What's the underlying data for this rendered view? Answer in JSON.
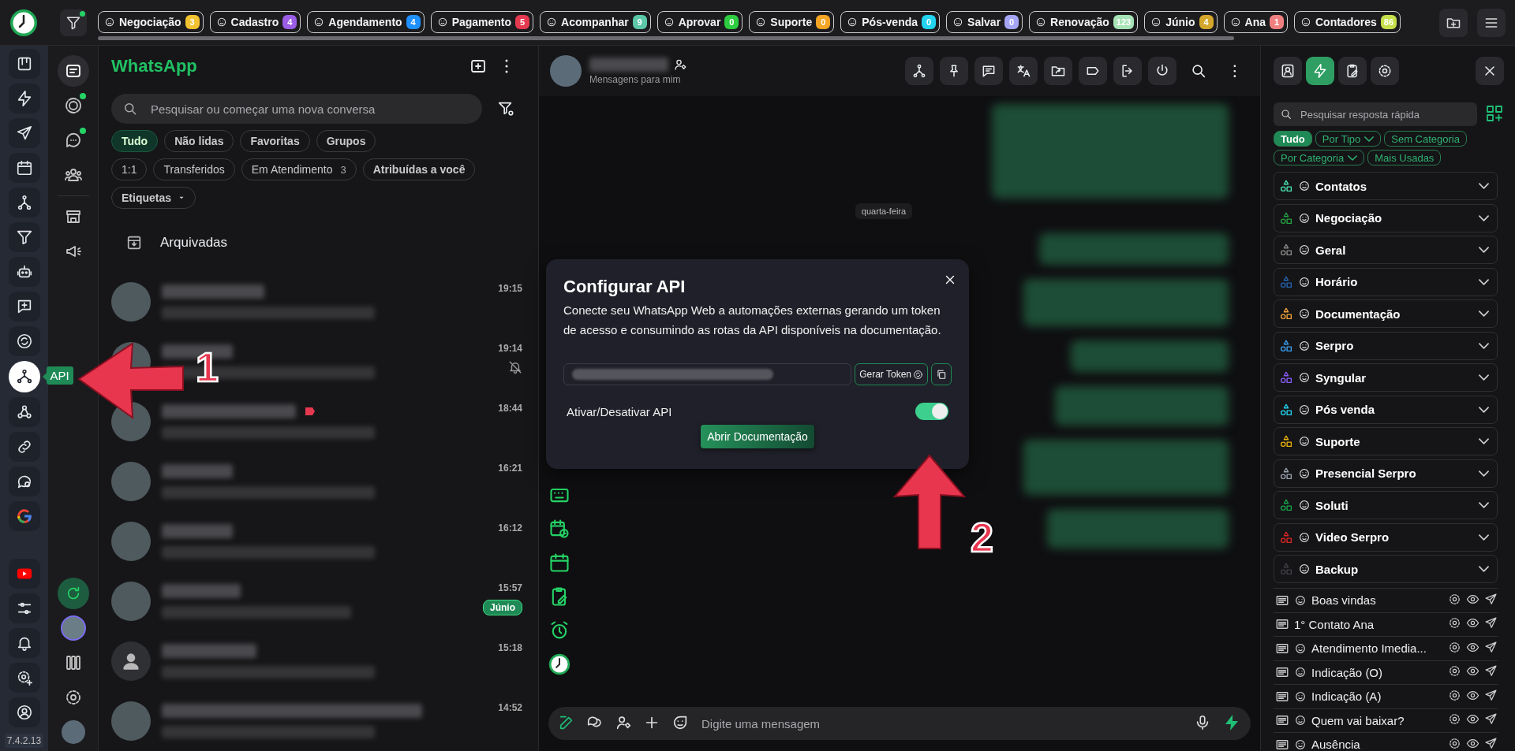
{
  "top_bar": {
    "tags": [
      {
        "label": "Negociação",
        "count": "3",
        "color": "#f2c230"
      },
      {
        "label": "Cadastro",
        "count": "4",
        "color": "#9b5de5"
      },
      {
        "label": "Agendamento",
        "count": "4",
        "color": "#1e90ff"
      },
      {
        "label": "Pagamento",
        "count": "5",
        "color": "#e53950"
      },
      {
        "label": "Acompanhar",
        "count": "9",
        "color": "#5cc8a8"
      },
      {
        "label": "Aprovar",
        "count": "0",
        "color": "#2ecc40"
      },
      {
        "label": "Suporte",
        "count": "0",
        "color": "#f5a524"
      },
      {
        "label": "Pós-venda",
        "count": "0",
        "color": "#22d3ee"
      },
      {
        "label": "Salvar",
        "count": "0",
        "color": "#a5a5f5"
      },
      {
        "label": "Renovação",
        "count": "123",
        "color": "#a7e3b7"
      },
      {
        "label": "Júnio",
        "count": "4",
        "color": "#d4a72c"
      },
      {
        "label": "Ana",
        "count": "1",
        "color": "#f08080"
      },
      {
        "label": "Contadores",
        "count": "86",
        "color": "#c5e04a"
      }
    ]
  },
  "left_rail": {
    "items": [
      {
        "kind": "kanban",
        "selected": false
      },
      {
        "kind": "bolt",
        "selected": false
      },
      {
        "kind": "send",
        "selected": false
      },
      {
        "kind": "calendar",
        "selected": false
      },
      {
        "kind": "hierarchy",
        "selected": false
      },
      {
        "kind": "filter",
        "selected": false
      },
      {
        "kind": "robot",
        "selected": false
      },
      {
        "kind": "message-plus",
        "selected": false
      },
      {
        "kind": "sync",
        "selected": false
      },
      {
        "kind": "api",
        "selected": true
      },
      {
        "kind": "webhook",
        "selected": false
      },
      {
        "kind": "link",
        "selected": false
      },
      {
        "kind": "chat-search",
        "selected": false
      },
      {
        "kind": "google",
        "selected": false
      }
    ],
    "bottom_items": [
      {
        "kind": "youtube",
        "selected": false
      },
      {
        "kind": "sliders",
        "selected": false
      },
      {
        "kind": "bell",
        "selected": false
      },
      {
        "kind": "gear-plus",
        "selected": false
      },
      {
        "kind": "user-circle",
        "selected": false
      }
    ],
    "tooltip": "API",
    "version": "7.4.2.13"
  },
  "nav_rail": {
    "groups": [
      [
        {
          "kind": "chats",
          "selected": true,
          "unread": false
        },
        {
          "kind": "status",
          "selected": false,
          "unread": true
        },
        {
          "kind": "channels",
          "selected": false,
          "unread": true
        },
        {
          "kind": "communities",
          "selected": false,
          "unread": false
        }
      ],
      [
        {
          "kind": "store",
          "selected": false,
          "unread": false
        },
        {
          "kind": "megaphone",
          "selected": false,
          "unread": false
        }
      ]
    ],
    "bottom_items": [
      {
        "kind": "refresh"
      },
      {
        "kind": "avatar"
      },
      {
        "kind": "columns"
      },
      {
        "kind": "gear"
      },
      {
        "kind": "logo"
      }
    ]
  },
  "chat_list": {
    "title": "WhatsApp",
    "search": {
      "placeholder": "Pesquisar ou começar uma nova conversa"
    },
    "filters": [
      [
        {
          "label": "Tudo",
          "selected": true
        },
        {
          "label": "Não lidas",
          "selected": false
        },
        {
          "label": "Favoritas",
          "selected": false
        },
        {
          "label": "Grupos",
          "selected": false
        }
      ],
      [
        {
          "label": "1:1",
          "selected": false
        },
        {
          "label": "Transferidos",
          "selected": false
        },
        {
          "label": "Em Atendimento",
          "count": "3",
          "selected": false
        },
        {
          "label": "Atribuídas a você",
          "selected": false
        }
      ]
    ],
    "labels_dropdown": "Etiquetas",
    "archived": "Arquivadas",
    "chats": [
      {
        "kind": "photo",
        "time": "19:15",
        "muted": false
      },
      {
        "kind": "photo",
        "time": "19:14",
        "muted": true
      },
      {
        "kind": "photo",
        "time": "18:44",
        "muted": false,
        "color": "#e53950"
      },
      {
        "kind": "photo",
        "time": "16:21",
        "muted": false
      },
      {
        "kind": "photo",
        "time": "16:12",
        "muted": false
      },
      {
        "kind": "photo",
        "time": "15:57",
        "muted": false,
        "tag": "Júnio"
      },
      {
        "kind": "default",
        "time": "15:18",
        "muted": false
      },
      {
        "kind": "photo",
        "time": "14:52",
        "muted": false
      }
    ]
  },
  "chat": {
    "status": "Mensagens para mim",
    "date": "quarta-feira",
    "composer": {
      "placeholder": "Digite uma mensagem"
    }
  },
  "modal": {
    "title": "Configurar API",
    "description": "Conecte seu WhatsApp Web a automações externas gerando um token de acesso e consumindo as rotas da API disponíveis na documentação.",
    "token_button": "Gerar Token",
    "toggle_label": "Ativar/Desativar API",
    "toggle_on": true,
    "doc_button": "Abrir Documentação"
  },
  "quick_replies": {
    "tabs": [
      {
        "kind": "contact",
        "selected": false
      },
      {
        "kind": "bolt",
        "selected": true
      },
      {
        "kind": "clipboard",
        "selected": false
      },
      {
        "kind": "gear",
        "selected": false
      }
    ],
    "search": {
      "placeholder": "Pesquisar resposta rápida"
    },
    "filters": [
      {
        "label": "Tudo",
        "selected": true,
        "dropdown": false
      },
      {
        "label": "Por Tipo",
        "selected": false,
        "dropdown": true
      },
      {
        "label": "Sem Categoria",
        "selected": false,
        "dropdown": false
      },
      {
        "label": "Por Categoria",
        "selected": false,
        "dropdown": true
      },
      {
        "label": "Mais Usadas",
        "selected": false,
        "dropdown": false
      }
    ],
    "categories": [
      {
        "label": "Contatos",
        "color": "#4be3b0"
      },
      {
        "label": "Negociação",
        "color": "#25a244"
      },
      {
        "label": "Geral",
        "color": "#8a8a8a"
      },
      {
        "label": "Horário",
        "color": "#2563b0"
      },
      {
        "label": "Documentação",
        "color": "#f2a33a"
      },
      {
        "label": "Serpro",
        "color": "#3aa0f2"
      },
      {
        "label": "Syngular",
        "color": "#8b5cf6"
      },
      {
        "label": "Pós venda",
        "color": "#22d3ee"
      },
      {
        "label": "Suporte",
        "color": "#eab308"
      },
      {
        "label": "Presencial Serpro",
        "color": "#9ca3af"
      },
      {
        "label": "Soluti",
        "color": "#16a34a"
      },
      {
        "label": "Video Serpro",
        "color": "#dc2626"
      },
      {
        "label": "Backup",
        "color": "#3f3f46"
      }
    ],
    "replies": [
      {
        "label": "Boas vindas",
        "emoji": true
      },
      {
        "label": "1° Contato Ana",
        "emoji": false
      },
      {
        "label": "Atendimento Imedia...",
        "emoji": true
      },
      {
        "label": "Indicação (O)",
        "emoji": true
      },
      {
        "label": "Indicação (A)",
        "emoji": true
      },
      {
        "label": "Quem vai baixar?",
        "emoji": true
      },
      {
        "label": "Ausência",
        "emoji": true
      }
    ]
  },
  "annotations": [
    {
      "label": "1"
    },
    {
      "label": "2"
    }
  ]
}
